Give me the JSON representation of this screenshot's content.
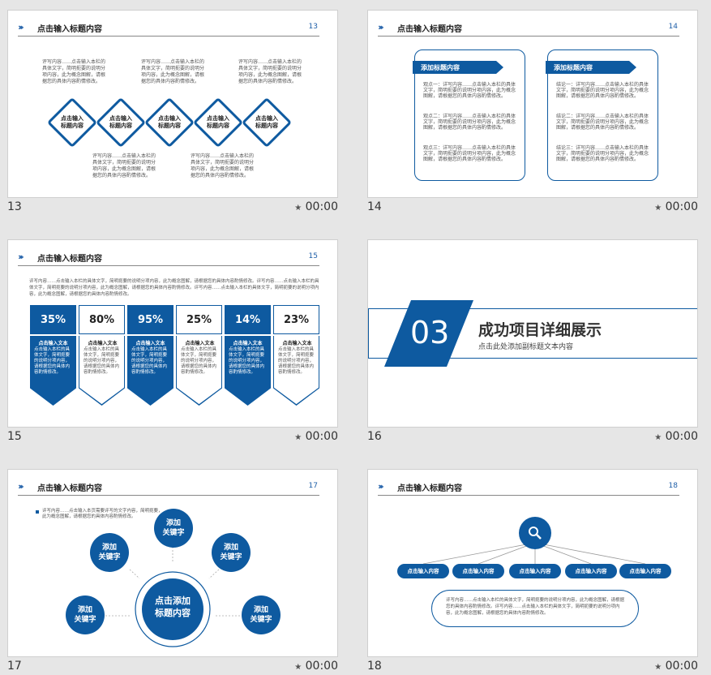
{
  "header_title": "点击输入标题内容",
  "time_label": "00:00",
  "star": "★",
  "slides": {
    "s13": {
      "number": "13",
      "texts_top": [
        "评写内容……点击输入本栏的具体文字，简明扼要的说明分项内容，此为概念图解，请根据您的具体内容酌情修改。",
        "评写内容……点击输入本栏的具体文字，简明扼要的说明分项内容，此为概念图解，请根据您的具体内容酌情修改。",
        "评写内容……点击输入本栏的具体文字，简明扼要的说明分项内容，此为概念图解，请根据您的具体内容酌情修改。"
      ],
      "texts_bottom": [
        "评写内容……点击输入本栏的具体文字，简明扼要的说明分项内容，此为概念图解，请根据您的具体内容酌情修改。",
        "评写内容……点击输入本栏的具体文字，简明扼要的说明分项内容，此为概念图解，请根据您的具体内容酌情修改。"
      ],
      "diamond_line1": "点击输入",
      "diamond_line2": "标题内容"
    },
    "s14": {
      "number": "14",
      "tag": "添加标题内容",
      "left_items": [
        "观点一：详写内容……点击输入本栏的具体文字，简明扼要的说明分项内容，此为概念图解，请根据您的具体内容酌情修改。",
        "观点二：详写内容……点击输入本栏的具体文字，简明扼要的说明分项内容，此为概念图解，请根据您的具体内容酌情修改。",
        "观点三：详写内容……点击输入本栏的具体文字，简明扼要的说明分项内容，此为概念图解，请根据您的具体内容酌情修改。"
      ],
      "right_items": [
        "结论一：详写内容……点击输入本栏的具体文字，简明扼要的说明分项内容，此为概念图解，请根据您的具体内容酌情修改。",
        "结论二：详写内容……点击输入本栏的具体文字，简明扼要的说明分项内容，此为概念图解，请根据您的具体内容酌情修改。",
        "结论三：详写内容……点击输入本栏的具体文字，简明扼要的说明分项内容，此为概念图解，请根据您的具体内容酌情修改。"
      ]
    },
    "s15": {
      "number": "15",
      "intro": "评写内容……点击输入本栏的具体文字，简明扼要的说明分项内容，此为概念图解，请根据您的具体内容酌情修改。评写内容……点击输入本栏的具体文字，简明扼要的说明分项内容，此为概念图解，请根据您的具体内容酌情修改。评写内容……点击输入本栏的具体文字，简明扼要的说明分项内容，此为概念图解，请根据您的具体内容酌情修改。",
      "columns": [
        {
          "pct": "35%",
          "title": "点击输入文本",
          "body": "点击输入本栏的具体文字，简明扼要的说明分项内容，请根据您的具体内容酌情修改。"
        },
        {
          "pct": "80%",
          "title": "点击输入文本",
          "body": "点击输入本栏的具体文字，简明扼要的说明分项内容，请根据您的具体内容酌情修改。"
        },
        {
          "pct": "95%",
          "title": "点击输入文本",
          "body": "点击输入本栏的具体文字，简明扼要的说明分项内容，请根据您的具体内容酌情修改。"
        },
        {
          "pct": "25%",
          "title": "点击输入文本",
          "body": "点击输入本栏的具体文字，简明扼要的说明分项内容，请根据您的具体内容酌情修改。"
        },
        {
          "pct": "14%",
          "title": "点击输入文本",
          "body": "点击输入本栏的具体文字，简明扼要的说明分项内容，请根据您的具体内容酌情修改。"
        },
        {
          "pct": "23%",
          "title": "点击输入文本",
          "body": "点击输入本栏的具体文字，简明扼要的说明分项内容，请根据您的具体内容酌情修改。"
        }
      ]
    },
    "s16": {
      "number": "16",
      "big_num": "03",
      "title": "成功项目详细展示",
      "subtitle": "点击此处添加副标题文本内容"
    },
    "s17": {
      "number": "17",
      "note": "评写内容……点击输入本页需要评写的文字内容，简明扼要，此为概念图解，请根据您的具体内容酌情修改。",
      "center_line1": "点击添加",
      "center_line2": "标题内容",
      "kw_line1": "添加",
      "kw_line2": "关键字"
    },
    "s18": {
      "number": "18",
      "pill": "点击输入内容",
      "body": "评写内容……点击输入本栏的具体文字，简明扼要的说明分项内容，此为概念图解，请根据您的具体内容酌情修改。评写内容……点击输入本栏的具体文字，简明扼要的说明分项内容，此为概念图解，请根据您的具体内容酌情修改。"
    }
  },
  "colors": {
    "accent": "#0e5aa0",
    "arrow_orange": "#e8a530"
  }
}
